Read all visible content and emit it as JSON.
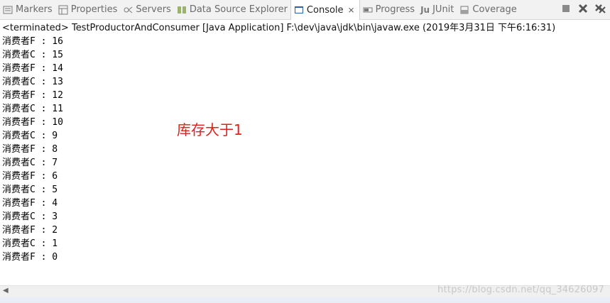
{
  "tabs": [
    {
      "label": "Markers",
      "icon": "markers-icon",
      "active": false
    },
    {
      "label": "Properties",
      "icon": "properties-icon",
      "active": false
    },
    {
      "label": "Servers",
      "icon": "servers-icon",
      "active": false
    },
    {
      "label": "Data Source Explorer",
      "icon": "data-source-icon",
      "active": false
    },
    {
      "label": "Console",
      "icon": "console-icon",
      "active": true
    },
    {
      "label": "Progress",
      "icon": "progress-icon",
      "active": false
    },
    {
      "label": "JUnit",
      "icon": "junit-icon",
      "active": false
    },
    {
      "label": "Coverage",
      "icon": "coverage-icon",
      "active": false
    }
  ],
  "junit_prefix": "Ju",
  "console_header": "<terminated> TestProductorAndConsumer [Java Application] F:\\dev\\java\\jdk\\bin\\javaw.exe (2019年3月31日 下午6:16:31)",
  "output_lines": [
    "消费者F : 16",
    "消费者C : 15",
    "消费者F : 14",
    "消费者C : 13",
    "消费者F : 12",
    "消费者C : 11",
    "消费者F : 10",
    "消费者C : 9",
    "消费者F : 8",
    "消费者C : 7",
    "消费者F : 6",
    "消费者C : 5",
    "消费者F : 4",
    "消费者C : 3",
    "消费者F : 2",
    "消费者C : 1",
    "消费者F : 0"
  ],
  "annotation": "库存大于1",
  "watermark": "https://blog.csdn.net/qq_34626097",
  "colors": {
    "annotation": "#e0201b",
    "tabbar": "#f2f2f2"
  }
}
